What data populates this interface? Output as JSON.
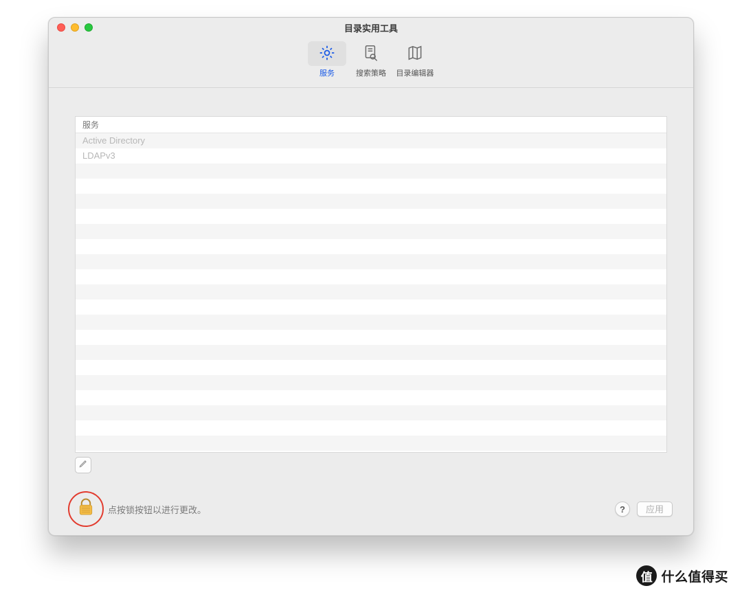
{
  "window": {
    "title": "目录实用工具"
  },
  "toolbar": {
    "items": [
      {
        "id": "services",
        "label": "服务",
        "active": true
      },
      {
        "id": "search",
        "label": "搜索策略",
        "active": false
      },
      {
        "id": "editor",
        "label": "目录编辑器",
        "active": false
      }
    ]
  },
  "table": {
    "header": "服务",
    "rows": [
      "Active Directory",
      "LDAPv3",
      "",
      "",
      "",
      "",
      "",
      "",
      "",
      "",
      "",
      "",
      "",
      "",
      "",
      "",
      "",
      "",
      "",
      "",
      "",
      ""
    ]
  },
  "footer": {
    "lock_text": "点按锁按钮以进行更改。",
    "help_label": "?",
    "apply_label": "应用"
  },
  "watermark": {
    "badge": "值",
    "text": "什么值得买"
  }
}
